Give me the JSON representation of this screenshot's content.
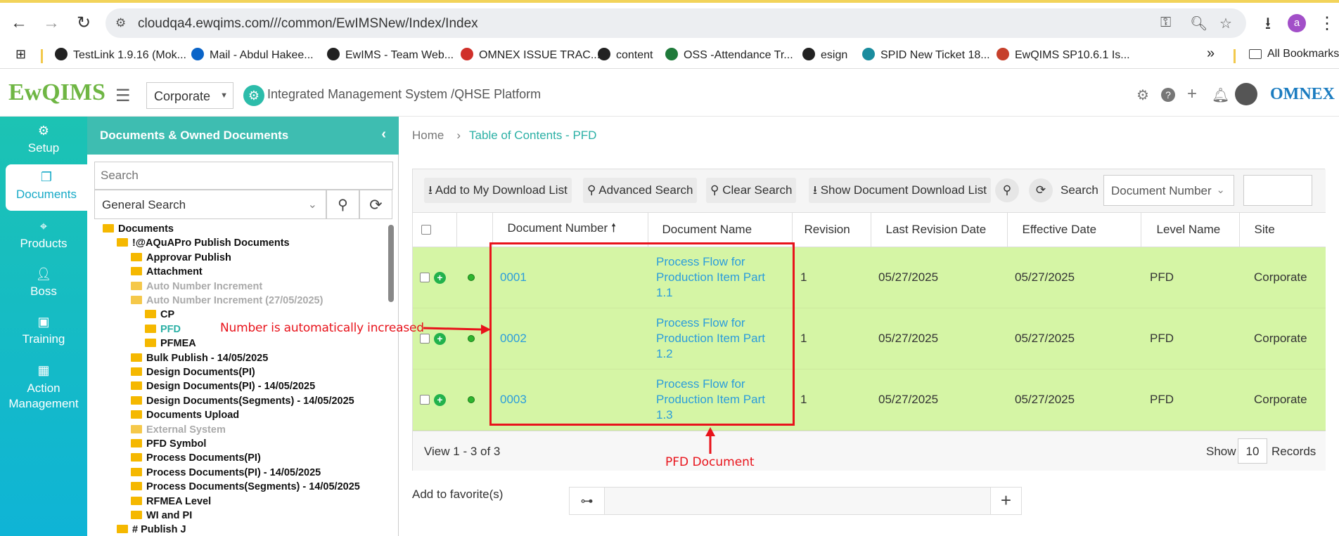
{
  "browser": {
    "url": "cloudqa4.ewqims.com///common/EwIMSNew/Index/Index",
    "profile_initial": "a",
    "bookmarks": [
      {
        "label": "TestLink 1.9.16 (Mok...",
        "color": "#222"
      },
      {
        "label": "Mail - Abdul Hakee...",
        "color": "#0a64c8"
      },
      {
        "label": "EwIMS - Team Web...",
        "color": "#222"
      },
      {
        "label": "OMNEX ISSUE TRAC...",
        "color": "#d0302a"
      },
      {
        "label": "content",
        "color": "#222"
      },
      {
        "label": "OSS -Attendance Tr...",
        "color": "#1f7a3a"
      },
      {
        "label": "esign",
        "color": "#222"
      },
      {
        "label": "SPID New Ticket 18...",
        "color": "#1a8c9e"
      },
      {
        "label": "EwQIMS SP10.6.1 Is...",
        "color": "#c6402b"
      }
    ],
    "overflow": "»",
    "all_bookmarks": "All Bookmarks"
  },
  "header": {
    "logo_text": "EwQIMS",
    "company_select": "Corporate",
    "platform_title": "Integrated Management System /QHSE Platform",
    "brand": "OMNEX"
  },
  "sidebar": {
    "items": [
      {
        "label": "Setup",
        "icon": "gears-icon"
      },
      {
        "label": "Documents",
        "icon": "documents-icon"
      },
      {
        "label": "Products",
        "icon": "products-icon"
      },
      {
        "label": "Boss",
        "icon": "user-icon"
      },
      {
        "label": "Training",
        "icon": "training-icon"
      },
      {
        "label": "Action\nManagement",
        "icon": "building-icon"
      }
    ],
    "active": "Documents"
  },
  "tree": {
    "title": "Documents & Owned Documents",
    "search_placeholder": "Search",
    "search_mode": "General Search",
    "nodes": [
      {
        "label": "Documents",
        "level": 0,
        "state": "normal"
      },
      {
        "label": "!@AQuAPro Publish Documents",
        "level": 1,
        "state": "normal"
      },
      {
        "label": "Approvar Publish",
        "level": 2,
        "state": "normal"
      },
      {
        "label": "Attachment",
        "level": 2,
        "state": "normal"
      },
      {
        "label": "Auto Number Increment",
        "level": 2,
        "state": "grey"
      },
      {
        "label": "Auto Number Increment (27/05/2025)",
        "level": 2,
        "state": "grey"
      },
      {
        "label": "CP",
        "level": 3,
        "state": "normal"
      },
      {
        "label": "PFD",
        "level": 3,
        "state": "selected"
      },
      {
        "label": "PFMEA",
        "level": 3,
        "state": "normal"
      },
      {
        "label": "Bulk Publish - 14/05/2025",
        "level": 2,
        "state": "normal"
      },
      {
        "label": "Design Documents(PI)",
        "level": 2,
        "state": "normal"
      },
      {
        "label": "Design Documents(PI) - 14/05/2025",
        "level": 2,
        "state": "normal"
      },
      {
        "label": "Design Documents(Segments) - 14/05/2025",
        "level": 2,
        "state": "normal"
      },
      {
        "label": "Documents Upload",
        "level": 2,
        "state": "normal"
      },
      {
        "label": "External System",
        "level": 2,
        "state": "grey"
      },
      {
        "label": "PFD Symbol",
        "level": 2,
        "state": "normal"
      },
      {
        "label": "Process Documents(PI)",
        "level": 2,
        "state": "normal"
      },
      {
        "label": "Process Documents(PI) - 14/05/2025",
        "level": 2,
        "state": "normal"
      },
      {
        "label": "Process Documents(Segments) - 14/05/2025",
        "level": 2,
        "state": "normal"
      },
      {
        "label": "RFMEA Level",
        "level": 2,
        "state": "normal"
      },
      {
        "label": "WI and PI",
        "level": 2,
        "state": "normal"
      },
      {
        "label": "# Publish J",
        "level": 1,
        "state": "normal"
      }
    ]
  },
  "breadcrumb": {
    "home": "Home",
    "separator": "›",
    "current": "Table of Contents - PFD"
  },
  "toolbar": {
    "add_download": "Add to My Download List",
    "advanced_search": "Advanced Search",
    "clear_search": "Clear Search",
    "show_download": "Show Document Download List",
    "search_label": "Search",
    "search_field": "Document Number"
  },
  "grid": {
    "columns": [
      "Document Number",
      "Document Name",
      "Revision",
      "Last Revision Date",
      "Effective Date",
      "Level Name",
      "Site"
    ],
    "sort_indicator": "🠕",
    "rows": [
      {
        "number": "0001",
        "name_lines": [
          "Process Flow for",
          "Production Item Part",
          "1.1"
        ],
        "revision": "1",
        "last_revision_date": "05/27/2025",
        "effective_date": "05/27/2025",
        "level": "PFD",
        "site": "Corporate"
      },
      {
        "number": "0002",
        "name_lines": [
          "Process Flow for",
          "Production Item Part",
          "1.2"
        ],
        "revision": "1",
        "last_revision_date": "05/27/2025",
        "effective_date": "05/27/2025",
        "level": "PFD",
        "site": "Corporate"
      },
      {
        "number": "0003",
        "name_lines": [
          "Process Flow for",
          "Production Item Part",
          "1.3"
        ],
        "revision": "1",
        "last_revision_date": "05/27/2025",
        "effective_date": "05/27/2025",
        "level": "PFD",
        "site": "Corporate"
      }
    ],
    "view_count": "View 1 - 3 of 3",
    "show_label": "Show",
    "page_size": "10",
    "records_label": "Records"
  },
  "favorites": {
    "label": "Add to favorite(s)"
  },
  "annotations": {
    "number_note": "Number is automatically increased",
    "pfd_note": "PFD Document",
    "color": "#e8131b"
  }
}
